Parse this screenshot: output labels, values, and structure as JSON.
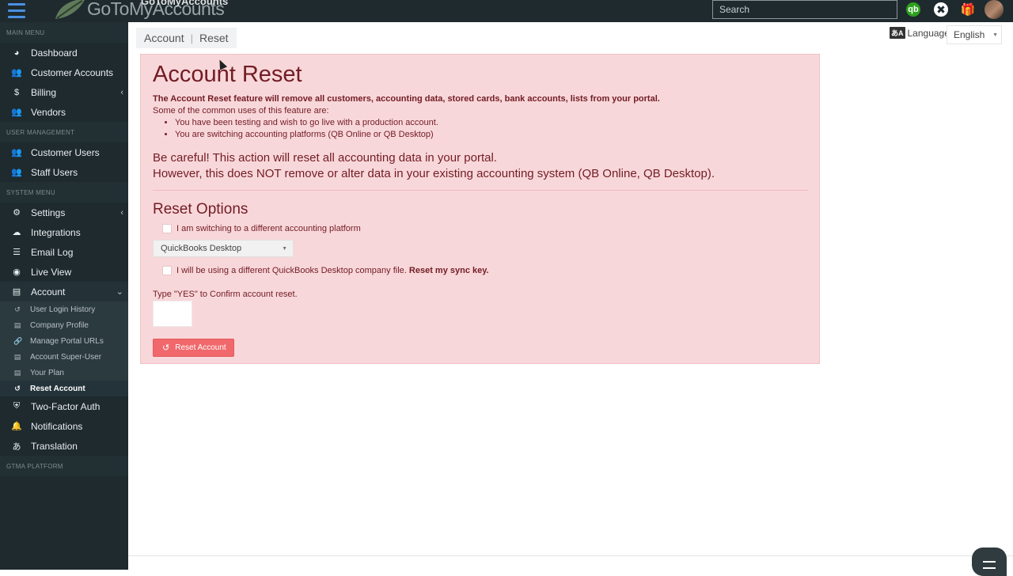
{
  "brand": {
    "name": "GoToMyAccounts",
    "name_top": "GoToMyAccounts"
  },
  "search": {
    "placeholder": "Search"
  },
  "topbar_icons": [
    "quickbooks-icon",
    "support-icon",
    "gift-icon"
  ],
  "sidebar": {
    "sections": [
      {
        "label": "MAIN MENU",
        "items": [
          {
            "label": "Dashboard",
            "icon": "dashboard-icon"
          },
          {
            "label": "Customer Accounts",
            "icon": "users-icon"
          },
          {
            "label": "Billing",
            "icon": "dollar-icon",
            "chevron": "left"
          },
          {
            "label": "Vendors",
            "icon": "users-icon"
          }
        ]
      },
      {
        "label": "USER MANAGEMENT",
        "items": [
          {
            "label": "Customer Users",
            "icon": "users-icon"
          },
          {
            "label": "Staff Users",
            "icon": "users-icon"
          }
        ]
      },
      {
        "label": "SYSTEM MENU",
        "items": [
          {
            "label": "Settings",
            "icon": "gear-icon",
            "chevron": "left"
          },
          {
            "label": "Integrations",
            "icon": "cloud-icon"
          },
          {
            "label": "Email Log",
            "icon": "list-icon"
          },
          {
            "label": "Live View",
            "icon": "eye-icon"
          },
          {
            "label": "Account",
            "icon": "account-icon",
            "chevron": "down"
          }
        ]
      },
      {
        "label": "GTMA PLATFORM",
        "items": []
      }
    ],
    "account_sub": [
      {
        "label": "User Login History",
        "icon": "history-icon"
      },
      {
        "label": "Company Profile",
        "icon": "profile-icon"
      },
      {
        "label": "Manage Portal URLs",
        "icon": "link-icon"
      },
      {
        "label": "Account Super-User",
        "icon": "profile-icon"
      },
      {
        "label": "Your Plan",
        "icon": "profile-icon"
      },
      {
        "label": "Reset Account",
        "icon": "reset-icon",
        "current": true
      }
    ],
    "after_account": [
      {
        "label": "Two-Factor Auth",
        "icon": "shield-icon"
      },
      {
        "label": "Notifications",
        "icon": "bell-icon"
      },
      {
        "label": "Translation",
        "icon": "translate-icon"
      }
    ]
  },
  "breadcrumb": {
    "parent": "Account",
    "current": "Reset"
  },
  "language": {
    "label": "Language:",
    "value": "English"
  },
  "panel": {
    "title": "Account Reset",
    "intro_bold": "The Account Reset feature will remove all customers, accounting data, stored cards, bank accounts, lists from your portal.",
    "intro": "Some of the common uses of this feature are:",
    "uses": [
      "You have been testing and wish to go live with a production account.",
      "You are switching accounting platforms (QB Online or QB Desktop)"
    ],
    "warning_1": "Be careful! This action will reset all accounting data in your portal.",
    "warning_2": "However, this does NOT remove or alter data in your existing accounting system (QB Online, QB Desktop).",
    "options_title": "Reset Options",
    "option_switch_label": "I am switching to a different accounting platform",
    "platform_value": "QuickBooks Desktop",
    "option_file_label": "I will be using a different QuickBooks Desktop company file.",
    "option_file_bold": "Reset my sync key.",
    "confirm_label": "Type \"YES\" to Confirm account reset.",
    "confirm_value": "",
    "reset_button": "Reset Account"
  },
  "colors": {
    "sidebar_bg": "#1e2a2e",
    "alert_bg": "#f8d7da",
    "alert_text": "#721c24",
    "reset_button": "#f0686b",
    "qb_green": "#2ca01c"
  }
}
